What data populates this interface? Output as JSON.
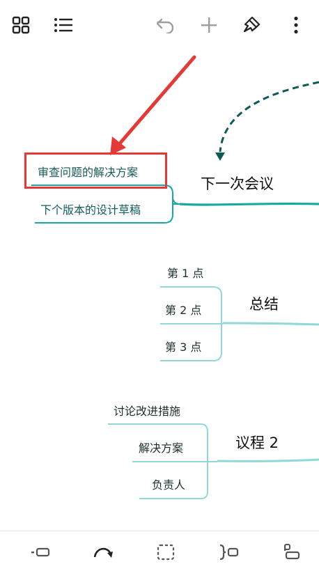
{
  "toolbar": {
    "left_icons": [
      "grid-view-icon",
      "outline-list-icon"
    ],
    "right_icons": [
      "undo-icon",
      "add-icon",
      "format-brush-icon",
      "more-vert-icon"
    ]
  },
  "mindmap": {
    "topics": [
      {
        "label": "下一次会议",
        "children": [
          "审查问题的解决方案",
          "下个版本的设计草稿"
        ]
      },
      {
        "label": "总结",
        "children": [
          "第 1 点",
          "第 2 点",
          "第 3 点"
        ]
      },
      {
        "label": "议程 2",
        "children": [
          "讨论改进措施",
          "解决方案",
          "负责人"
        ]
      }
    ],
    "highlighted_item": "审查问题的解决方案"
  },
  "colors": {
    "branch_primary": "#16a9a4",
    "branch_secondary": "#8fd9d6",
    "dashed_link": "#0e5a57",
    "annotation_red": "#e53935",
    "icon_gray": "#9e9e9e",
    "icon_dark": "#222222"
  },
  "bottom_toolbar": {
    "icons": [
      "add-sibling-topic-icon",
      "relationship-curve-icon",
      "boundary-icon",
      "summary-icon",
      "add-child-topic-icon"
    ]
  }
}
